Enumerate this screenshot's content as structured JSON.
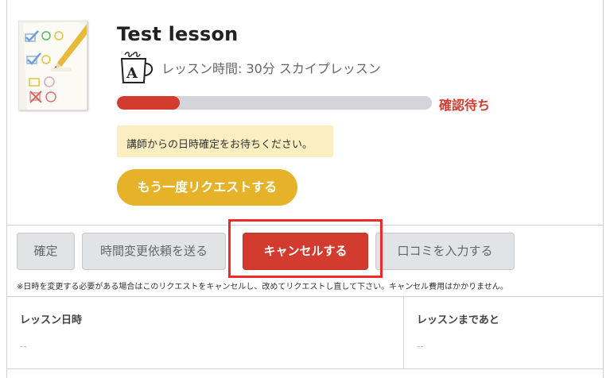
{
  "lesson": {
    "title": "Test lesson",
    "meta": "レッスン時間: 30分 スカイプレッスン",
    "progress_fraction": 0.2,
    "status": "確認待ち"
  },
  "notice": {
    "text": "講師からの日時確定をお待ちください。"
  },
  "actions": {
    "rerequest_label": "もう一度リクエストする",
    "confirm_label": "確定",
    "reschedule_label": "時間変更依頼を送る",
    "cancel_label": "キャンセルする",
    "review_label": "口コミを入力する"
  },
  "disclaimer": "※日時を変更する必要がある場合はこのリクエストをキャンセルし、改めてリクエストし直して下さい。キャンセル費用はかかりません。",
  "details": {
    "datetime_label": "レッスン日時",
    "datetime_value": "--",
    "countdown_label": "レッスンまであと",
    "countdown_value": "--"
  },
  "colors": {
    "accent_red": "#d33b2e",
    "accent_yellow": "#e5b229",
    "notice_bg": "#fbeec0",
    "highlight_border": "#f02a2a"
  },
  "icons": {
    "lesson_thumbnail": "quiz-sheet-image",
    "lesson_type": "coffee-mug-icon"
  }
}
